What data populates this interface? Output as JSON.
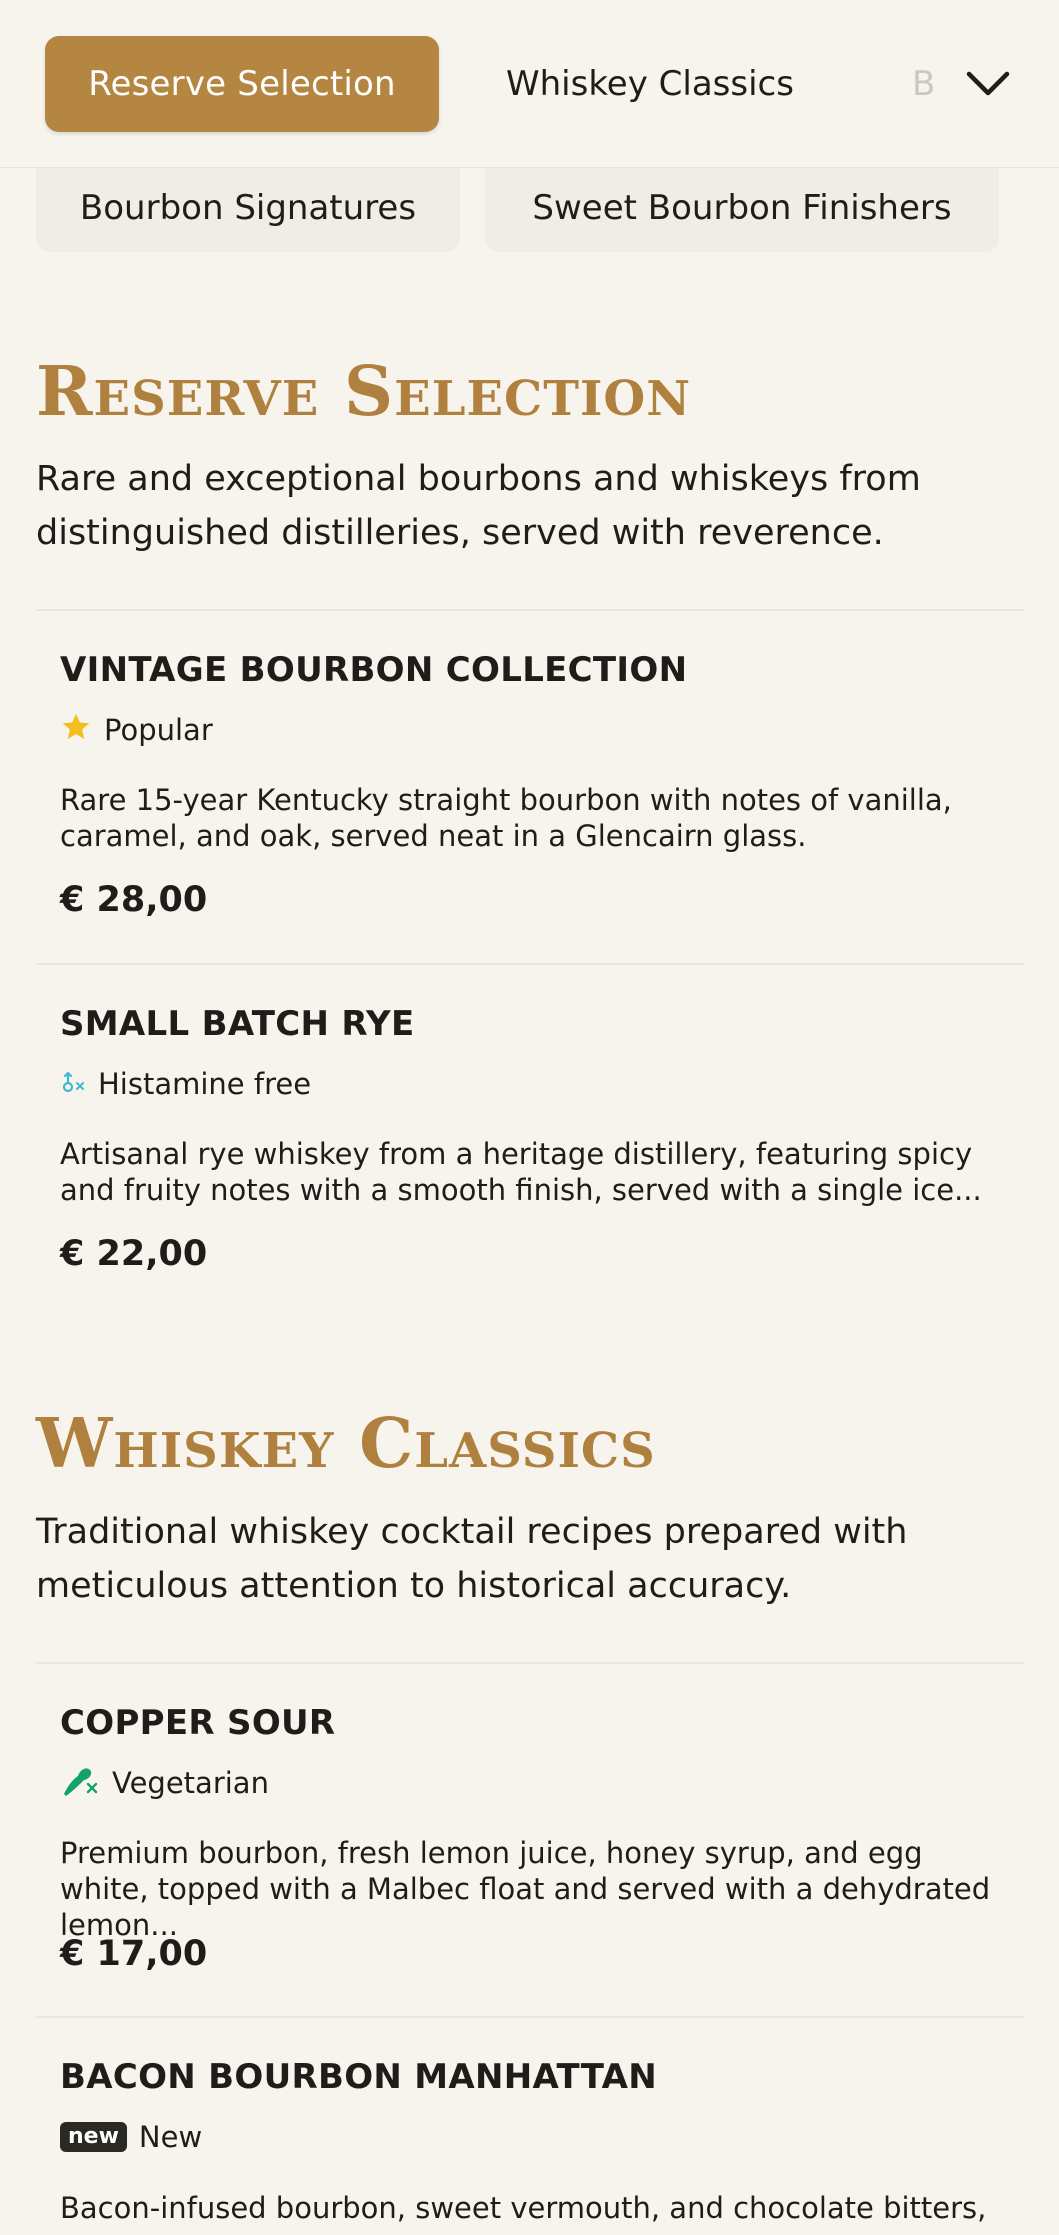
{
  "category_bar": {
    "active": "Reserve Selection",
    "next": "Whiskey Classics",
    "faded_partial": "B",
    "row2": [
      "Bourbon Signatures",
      "Sweet Bourbon Finishers"
    ]
  },
  "sections": [
    {
      "title": "Reserve Selection",
      "description": "Rare and exceptional bourbons and whiskeys from distinguished distilleries, served with reverence.",
      "items": [
        {
          "name": "VINTAGE BOURBON COLLECTION",
          "tag": "Popular",
          "tag_icon": "star-icon",
          "description": "Rare 15-year Kentucky straight bourbon with notes of vanilla, caramel, and oak, served neat in a Glencairn glass.",
          "price": "€ 28,00"
        },
        {
          "name": "SMALL BATCH RYE",
          "tag": "Histamine free",
          "tag_icon": "histamine-free-icon",
          "description": "Artisanal rye whiskey from a heritage distillery, featuring spicy and fruity notes with a smooth finish, served with a single ice...",
          "price": "€ 22,00"
        }
      ]
    },
    {
      "title": "Whiskey Classics",
      "description": "Traditional whiskey cocktail recipes prepared with meticulous attention to historical accuracy.",
      "items": [
        {
          "name": "COPPER SOUR",
          "tag": "Vegetarian",
          "tag_icon": "vegetarian-icon",
          "description": "Premium bourbon, fresh lemon juice, honey syrup, and egg white, topped with a Malbec float and served with a dehydrated lemon...",
          "price": "€ 17,00"
        },
        {
          "name": "BACON BOURBON MANHATTAN",
          "tag": "New",
          "tag_icon": "new-badge-icon",
          "badge_text": "new",
          "description": "Bacon-infused bourbon, sweet vermouth, and chocolate bitters,",
          "price": ""
        }
      ]
    }
  ],
  "colors": {
    "accent": "#b48642",
    "title_gold": "#b0803f",
    "background": "#f7f4ee",
    "star": "#f4c01e",
    "histamine": "#3fb8d6",
    "vegetarian": "#14a26a"
  }
}
